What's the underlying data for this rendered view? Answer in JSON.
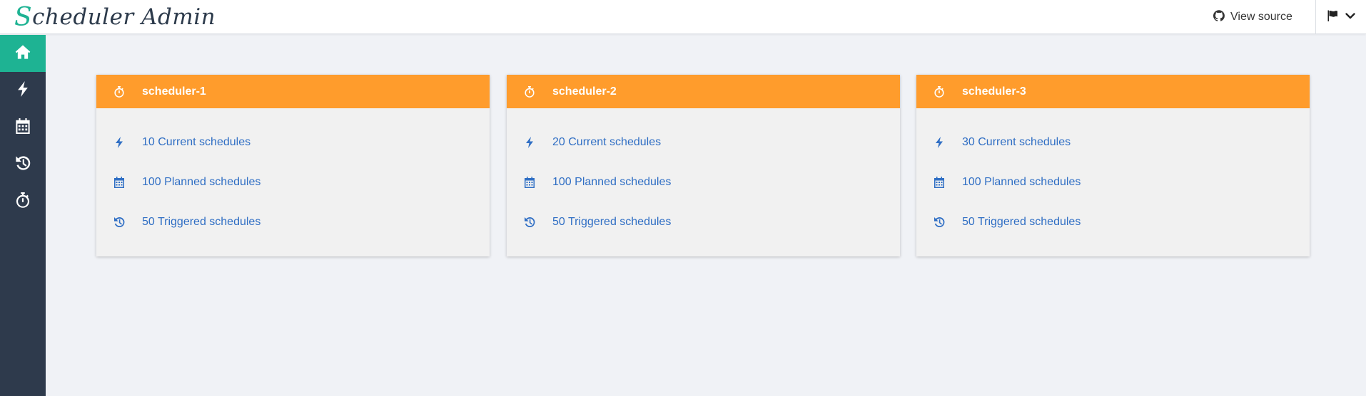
{
  "app": {
    "brand_first": "S",
    "brand_rest": "cheduler Admin",
    "view_source_label": "View source"
  },
  "icons": {
    "github": "github-icon",
    "flag": "flag-icon",
    "chevron": "chevron-down-icon",
    "home": "home-icon",
    "bolt": "bolt-icon",
    "calendar": "calendar-icon",
    "history": "history-icon",
    "stopwatch": "stopwatch-icon"
  },
  "colors": {
    "accent": "#1eb393",
    "sidebar": "#2e3a4c",
    "card_header": "#ff9c2c",
    "link": "#2f6ec4"
  },
  "sidebar": {
    "items": [
      {
        "icon": "home-icon",
        "active": true
      },
      {
        "icon": "bolt-icon",
        "active": false
      },
      {
        "icon": "calendar-icon",
        "active": false
      },
      {
        "icon": "history-icon",
        "active": false
      },
      {
        "icon": "stopwatch-icon",
        "active": false
      }
    ]
  },
  "schedulers": [
    {
      "name": "scheduler-1",
      "current": "10 Current schedules",
      "planned": "100 Planned schedules",
      "triggered": "50 Triggered schedules"
    },
    {
      "name": "scheduler-2",
      "current": "20 Current schedules",
      "planned": "100 Planned schedules",
      "triggered": "50 Triggered schedules"
    },
    {
      "name": "scheduler-3",
      "current": "30 Current schedules",
      "planned": "100 Planned schedules",
      "triggered": "50 Triggered schedules"
    }
  ]
}
